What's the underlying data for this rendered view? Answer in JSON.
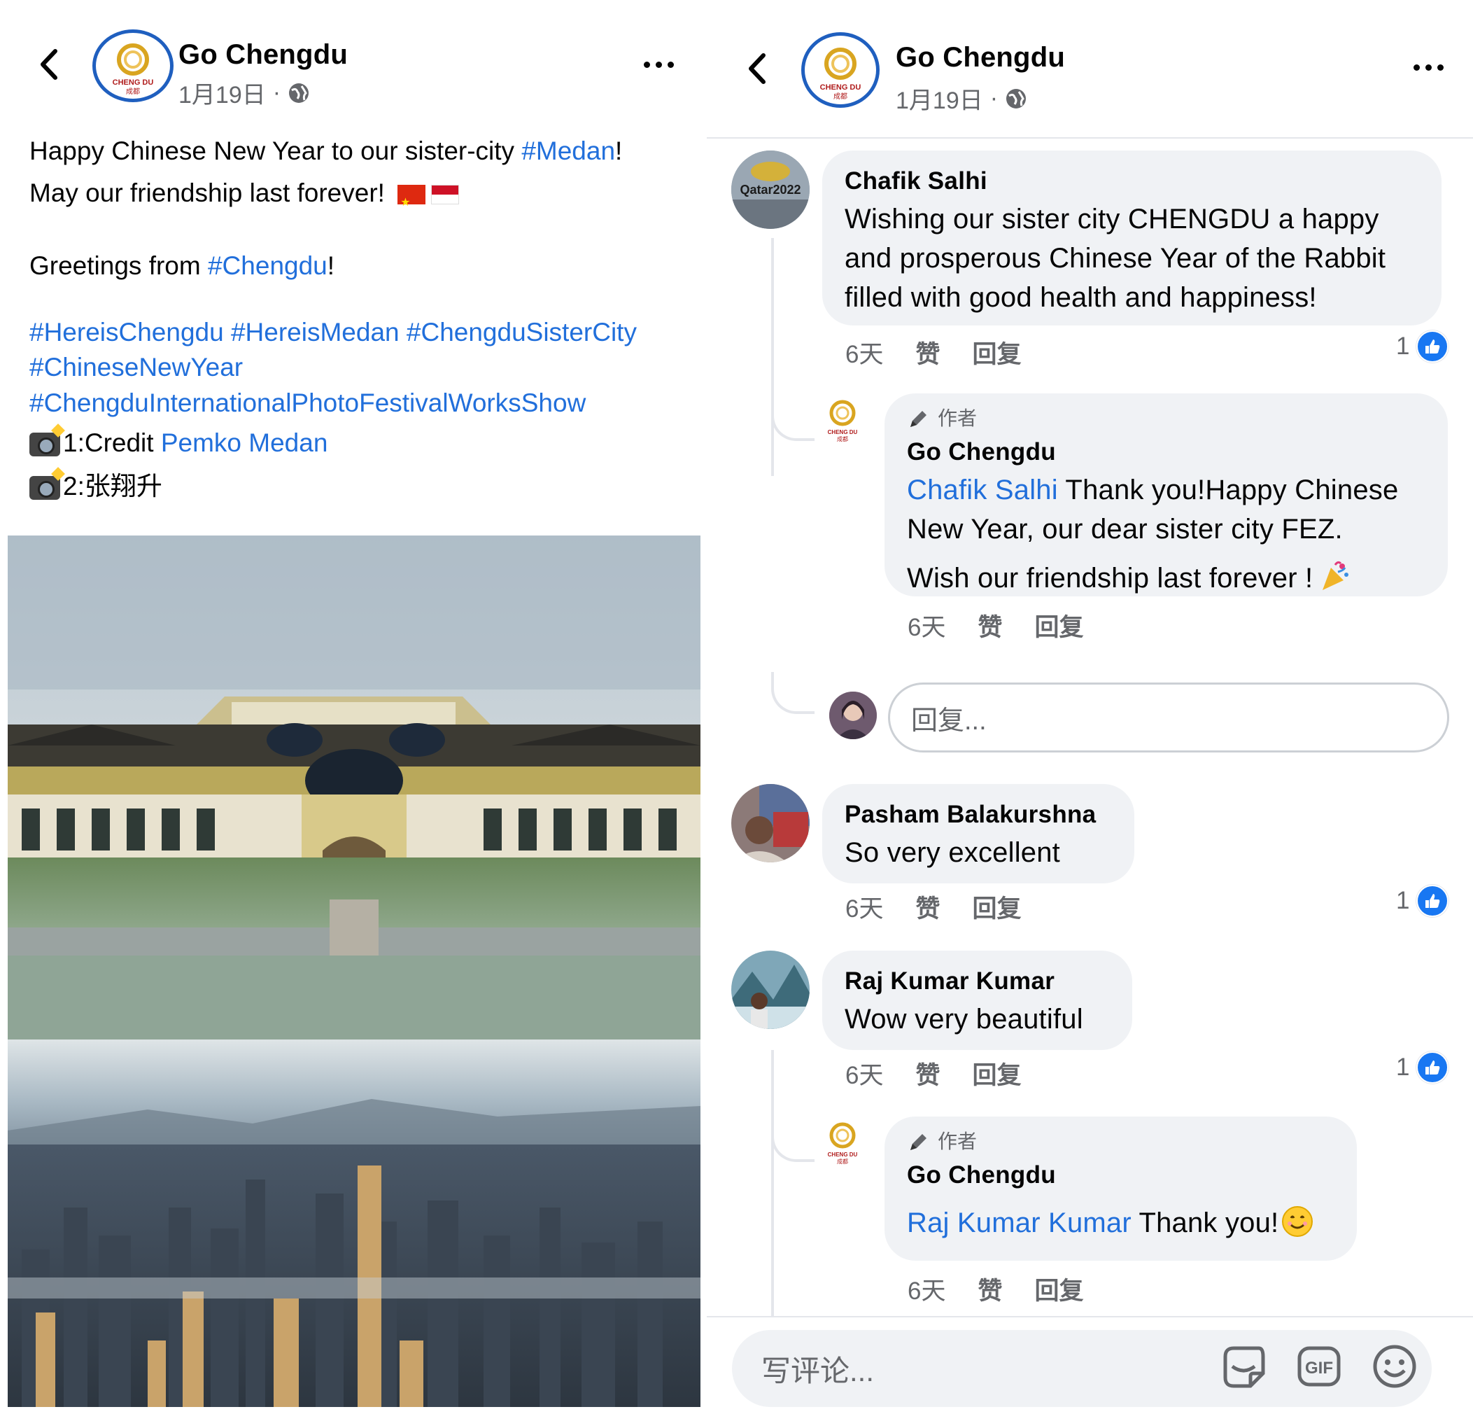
{
  "left": {
    "header": {
      "page_name": "Go Chengdu",
      "date": "1月19日",
      "dot": "·"
    },
    "post": {
      "line1_text": "Happy Chinese New Year to our sister-city ",
      "line1_tag": "#Medan",
      "line1_end": "!",
      "line2_text": "May our friendship last forever!",
      "line3_text": "Greetings from ",
      "line3_tag": "#Chengdu",
      "line3_end": "!",
      "tags_line1": [
        "#HereisChengdu",
        "#HereisMedan",
        "#ChengduSisterCity"
      ],
      "tags_line2": "#ChineseNewYear",
      "tags_line3": "#ChengduInternationalPhotoFestivalWorksShow",
      "credit1_prefix": "1:Credit ",
      "credit1_name": "Pemko Medan",
      "credit2": "2:张翔升"
    },
    "logo_text": "CHENG DU",
    "logo_sub": "成都"
  },
  "right": {
    "header": {
      "page_name": "Go Chengdu",
      "date": "1月19日",
      "dot": "·"
    },
    "comments": [
      {
        "author": "Chafik Salhi",
        "lines": [
          "Wishing our sister city CHENGDU a happy",
          "and prosperous Chinese Year of the Rabbit",
          "filled with good health and happiness!"
        ],
        "time": "6天",
        "like": "赞",
        "reply": "回复",
        "reactions": "1",
        "avatar_text": "Qatar2022"
      },
      {
        "badge": "作者",
        "author": "Go Chengdu",
        "mention": "Chafik Salhi",
        "line1_rest": " Thank you!Happy Chinese",
        "line2": "New Year, our dear sister city FEZ.",
        "line3": "Wish our friendship last forever !",
        "time": "6天",
        "like": "赞",
        "reply": "回复"
      },
      {
        "author": "Pasham Balakurshna",
        "text": "So very excellent",
        "time": "6天",
        "like": "赞",
        "reply": "回复",
        "reactions": "1"
      },
      {
        "author": "Raj Kumar Kumar",
        "text": "Wow very beautiful",
        "time": "6天",
        "like": "赞",
        "reply": "回复",
        "reactions": "1"
      },
      {
        "badge": "作者",
        "author": "Go Chengdu",
        "mention": "Raj Kumar Kumar",
        "rest": " Thank you!",
        "time": "6天",
        "like": "赞",
        "reply": "回复"
      }
    ],
    "reply_placeholder": "回复...",
    "comment_placeholder": "写评论...",
    "gif_label": "GIF"
  },
  "colors": {
    "link": "#216fdb",
    "like_blue": "#1877f2",
    "bubble": "#f0f2f5",
    "meta_gray": "#65676b"
  },
  "icons": [
    "back-arrow-icon",
    "globe-icon",
    "more-icon",
    "camera-icon",
    "flag-china-icon",
    "flag-indonesia-icon",
    "pencil-icon",
    "like-icon",
    "party-popper-icon",
    "smile-emoji-icon",
    "sticker-icon",
    "gif-icon",
    "emoji-icon"
  ]
}
